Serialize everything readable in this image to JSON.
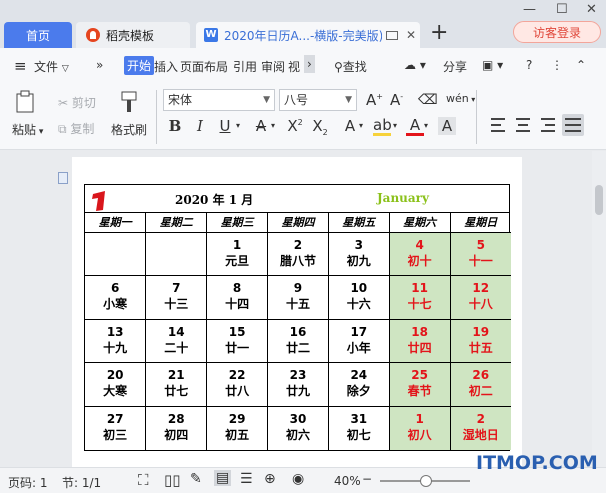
{
  "tabs": {
    "home": "首页",
    "docer": "稻壳模板",
    "document": "2020年日历A...-横版-完美版)"
  },
  "visitor_login": "访客登录",
  "menu": {
    "file": "文件",
    "items": [
      "开始",
      "插入",
      "页面布局",
      "引用",
      "审阅",
      "视"
    ],
    "find": "查找",
    "share": "分享"
  },
  "ribbon": {
    "paste": "粘贴",
    "cut": "剪切",
    "copy": "复制",
    "format_painter": "格式刷",
    "font_name": "宋体",
    "font_size": "八号"
  },
  "calendar": {
    "title": "2020 年 1 月",
    "english_month": "January",
    "weekdays": [
      "星期一",
      "星期二",
      "星期三",
      "星期四",
      "星期五",
      "星期六",
      "星期日"
    ],
    "weeks": [
      [
        {
          "d": "",
          "l": ""
        },
        {
          "d": "",
          "l": ""
        },
        {
          "d": "1",
          "l": "元旦"
        },
        {
          "d": "2",
          "l": "腊八节"
        },
        {
          "d": "3",
          "l": "初九"
        },
        {
          "d": "4",
          "l": "初十"
        },
        {
          "d": "5",
          "l": "十一"
        }
      ],
      [
        {
          "d": "6",
          "l": "小寒"
        },
        {
          "d": "7",
          "l": "十三"
        },
        {
          "d": "8",
          "l": "十四"
        },
        {
          "d": "9",
          "l": "十五"
        },
        {
          "d": "10",
          "l": "十六"
        },
        {
          "d": "11",
          "l": "十七"
        },
        {
          "d": "12",
          "l": "十八"
        }
      ],
      [
        {
          "d": "13",
          "l": "十九"
        },
        {
          "d": "14",
          "l": "二十"
        },
        {
          "d": "15",
          "l": "廿一"
        },
        {
          "d": "16",
          "l": "廿二"
        },
        {
          "d": "17",
          "l": "小年"
        },
        {
          "d": "18",
          "l": "廿四"
        },
        {
          "d": "19",
          "l": "廿五"
        }
      ],
      [
        {
          "d": "20",
          "l": "大寒"
        },
        {
          "d": "21",
          "l": "廿七"
        },
        {
          "d": "22",
          "l": "廿八"
        },
        {
          "d": "23",
          "l": "廿九"
        },
        {
          "d": "24",
          "l": "除夕"
        },
        {
          "d": "25",
          "l": "春节"
        },
        {
          "d": "26",
          "l": "初二"
        }
      ],
      [
        {
          "d": "27",
          "l": "初三"
        },
        {
          "d": "28",
          "l": "初四"
        },
        {
          "d": "29",
          "l": "初五"
        },
        {
          "d": "30",
          "l": "初六"
        },
        {
          "d": "31",
          "l": "初七"
        },
        {
          "d": "1",
          "l": "初八"
        },
        {
          "d": "2",
          "l": "湿地日"
        }
      ]
    ]
  },
  "status": {
    "page": "页码: 1",
    "section": "节: 1/1",
    "zoom": "40%"
  },
  "watermark": "ITMOP.COM",
  "colors": {
    "accent": "#4b7bec",
    "weekend_bg": "#cfe5c2",
    "weekend_text": "#e3141a",
    "english_month": "#8bc11a"
  }
}
